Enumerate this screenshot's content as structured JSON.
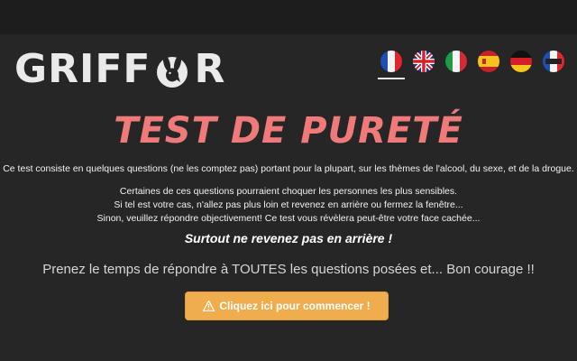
{
  "header": {
    "logo": {
      "left": "GRIFF",
      "right": "R"
    },
    "languages": [
      {
        "name": "fr-flag-icon",
        "active": true
      },
      {
        "name": "uk-flag-icon",
        "active": false
      },
      {
        "name": "it-flag-icon",
        "active": false
      },
      {
        "name": "es-flag-icon",
        "active": false
      },
      {
        "name": "de-flag-icon",
        "active": false
      },
      {
        "name": "fr-alt-flag-icon",
        "active": false
      }
    ]
  },
  "main": {
    "title": "TEST DE PURETÉ",
    "intro": "Ce test consiste en quelques questions (ne les comptez pas) portant pour la plupart, sur les thèmes de l'alcool, du sexe, et de la drogue.",
    "warning_lines": [
      "Certaines de ces questions pourraient choquer les personnes les plus sensibles.",
      "Si tel est votre cas, n'allez pas plus loin et revenez en arrière ou fermez la fenêtre...",
      "Sinon, veuillez répondre objectivement! Ce test vous révèlera peut-être votre face cachée..."
    ],
    "emphasis": "Surtout ne revenez pas en arrière !",
    "courage": "Prenez le temps de répondre à TOUTES les questions posées et... Bon courage !!",
    "start_button": "Cliquez ici pour commencer !"
  },
  "colors": {
    "background": "#262626",
    "title": "#f07a7a",
    "button": "#f0ad4e"
  }
}
